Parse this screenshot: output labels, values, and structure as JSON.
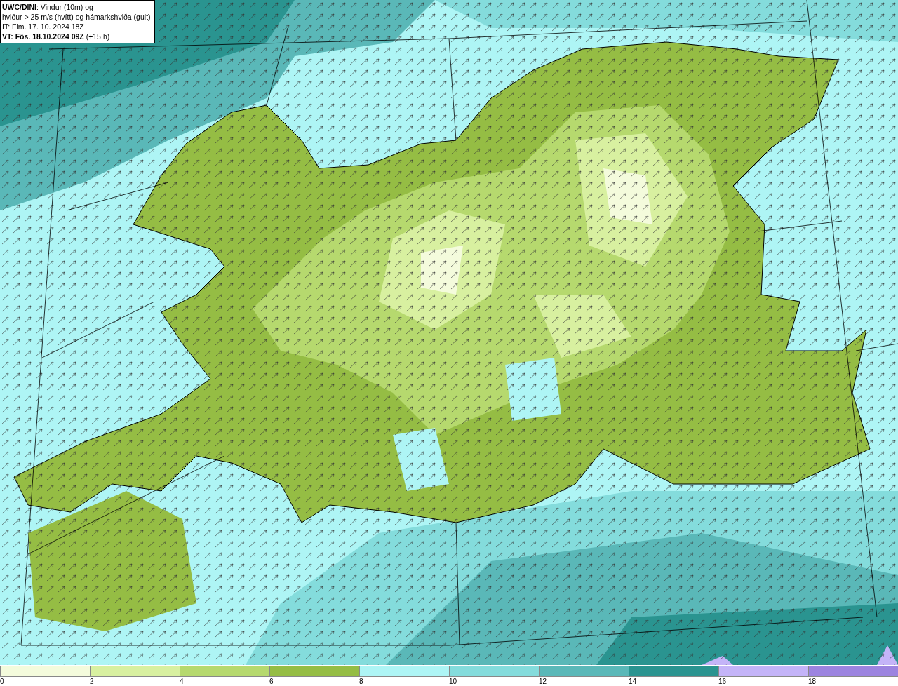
{
  "title_box": {
    "lines": [
      "**UWC/DINI**: Vindur (10m) og",
      "hviður > 25 m/s (hvítt) og hámarkshviða (gult)",
      "IT: Fim. 17. 10. 2024 18Z",
      "**VT: Fös. 18.10.2024 09Z** (+15 h)"
    ]
  },
  "legend": [
    {
      "label": "0",
      "color": "#f4fbdc"
    },
    {
      "label": "2",
      "color": "#d8f0a0"
    },
    {
      "label": "4",
      "color": "#b6d96e"
    },
    {
      "label": "6",
      "color": "#95bd44"
    },
    {
      "label": "8",
      "color": "#aef5f5"
    },
    {
      "label": "10",
      "color": "#84dcdc"
    },
    {
      "label": "12",
      "color": "#5ab8b8"
    },
    {
      "label": "14",
      "color": "#2a9490"
    },
    {
      "label": "16",
      "color": "#c4b4f8"
    },
    {
      "label": "18",
      "color": "#9c84e0"
    }
  ]
}
